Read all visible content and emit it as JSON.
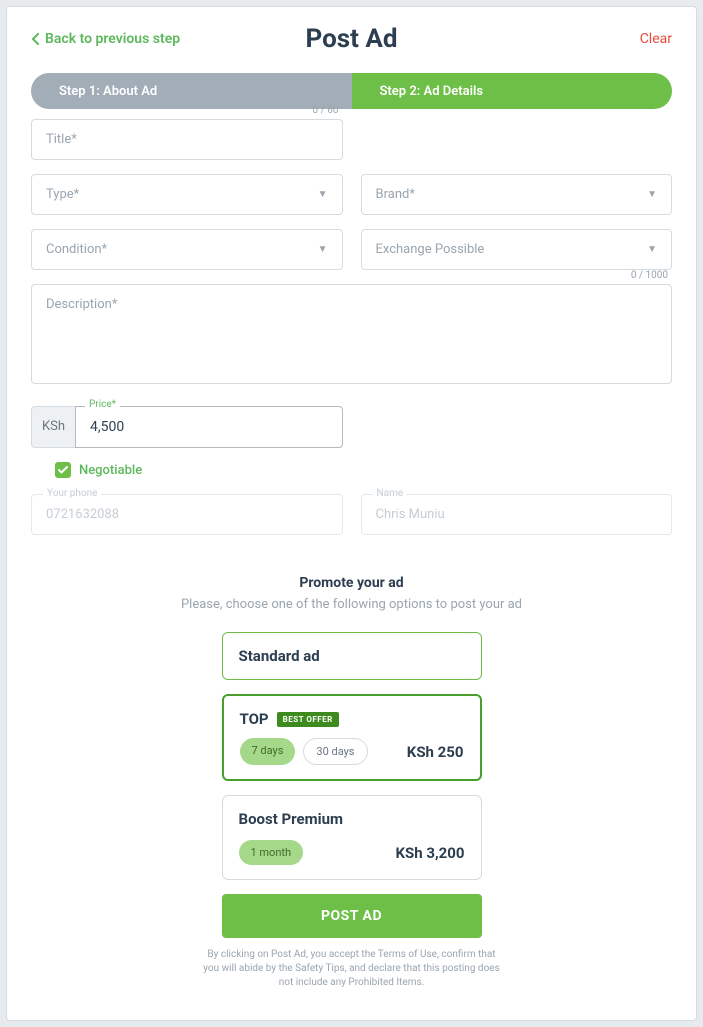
{
  "header": {
    "back_label": "Back to previous step",
    "title": "Post Ad",
    "clear_label": "Clear"
  },
  "steps": {
    "step1": "Step 1: About Ad",
    "step2": "Step 2: Ad Details"
  },
  "counters": {
    "title": "0 / 60",
    "description": "0 / 1000"
  },
  "fields": {
    "title_ph": "Title*",
    "type_ph": "Type*",
    "brand_ph": "Brand*",
    "condition_ph": "Condition*",
    "exchange_ph": "Exchange Possible",
    "description_ph": "Description*",
    "price_label": "Price*",
    "currency": "KSh",
    "price_value": "4,500",
    "negotiable_label": "Negotiable",
    "phone_label": "Your phone",
    "phone_value": "0721632088",
    "name_label": "Name",
    "name_value": "Chris Muniu"
  },
  "promote": {
    "title": "Promote your ad",
    "subtitle": "Please, choose one of the following options to post your ad",
    "standard": {
      "title": "Standard ad"
    },
    "top": {
      "title": "TOP",
      "badge": "BEST OFFER",
      "opt1": "7 days",
      "opt2": "30 days",
      "price": "KSh 250"
    },
    "boost": {
      "title": "Boost Premium",
      "opt1": "1 month",
      "price": "KSh 3,200"
    }
  },
  "post_button": "POST AD",
  "disclaimer": "By clicking on Post Ad, you accept the Terms of Use, confirm that you will abide by the Safety Tips, and declare that this posting does not include any Prohibited Items."
}
